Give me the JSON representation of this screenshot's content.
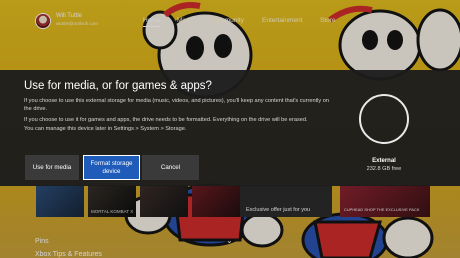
{
  "profile": {
    "gamertag": "Will Tuttle",
    "account": "wtuttle@outlook.com"
  },
  "nav": {
    "tabs": [
      {
        "label": "Home",
        "active": true
      },
      {
        "label": "Mixer",
        "active": false
      },
      {
        "label": "Community",
        "active": false
      },
      {
        "label": "Entertainment",
        "active": false
      },
      {
        "label": "Store",
        "active": false
      }
    ]
  },
  "home": {
    "tiles": [
      "",
      "MORTAL KOMBAT X",
      "",
      ""
    ],
    "exclusive_text": "Exclusive offer just for you",
    "promo_text": "CUPHEAD SHOP THE EXCLUSIVE PACK",
    "section_pins": "Pins",
    "section_tips": "Xbox Tips & Features",
    "scroll_icon": "chevron-down-icon"
  },
  "dialog": {
    "title": "Use for media, or for games & apps?",
    "body": [
      "If you choose to use this external storage for media (music, videos, and pictures), you'll keep any content that's currently on",
      "the drive.",
      "If you choose to use it for games and apps, the drive needs to be formatted. Everything on the drive will be erased.",
      "You can manage this device later in Settings > System > Storage."
    ],
    "buttons": {
      "media": "Use for media",
      "format": "Format storage device",
      "cancel": "Cancel"
    },
    "focused_button": "format",
    "drive": {
      "name": "External",
      "free": "232.8 GB free"
    }
  },
  "colors": {
    "accent_focus": "#1f5bb8",
    "background_yellow": "#e2bd1f",
    "dialog_bg": "#1c1c1c"
  }
}
